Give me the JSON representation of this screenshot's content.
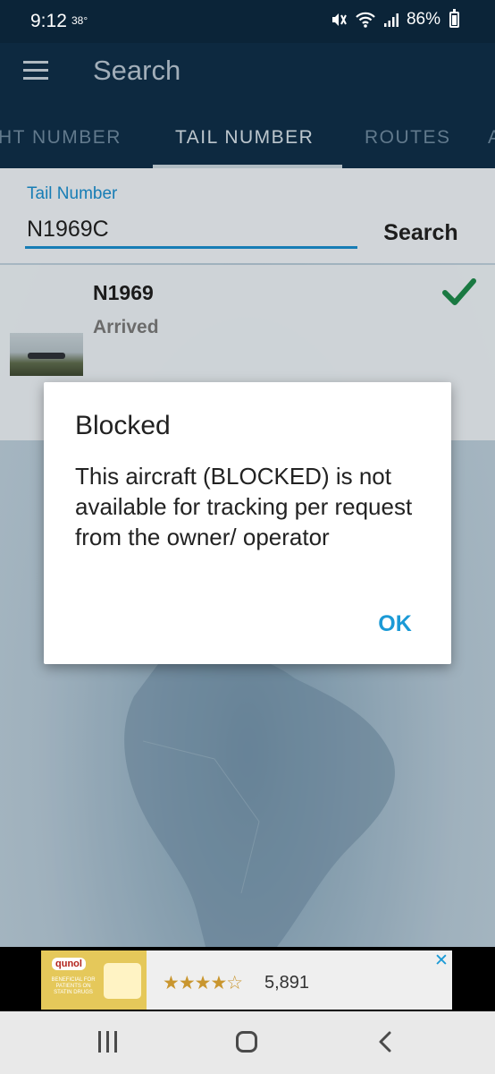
{
  "status_bar": {
    "time": "9:12",
    "temperature": "38°",
    "battery": "86%"
  },
  "app_bar": {
    "title": "Search"
  },
  "tabs": [
    {
      "label": "HT NUMBER",
      "active": false
    },
    {
      "label": "TAIL NUMBER",
      "active": true
    },
    {
      "label": "ROUTES",
      "active": false
    },
    {
      "label": "A",
      "active": false
    }
  ],
  "search": {
    "field_label": "Tail Number",
    "value": "N1969C",
    "button_label": "Search"
  },
  "result": {
    "registration": "N1969",
    "status": "Arrived",
    "status_icon": "checkmark-icon",
    "accent_color": "#1e8a4c"
  },
  "dialog": {
    "title": "Blocked",
    "message": "This aircraft (BLOCKED) is not available for tracking per request from the owner/ operator",
    "ok_label": "OK"
  },
  "ad": {
    "brand": "qunol",
    "product_text": "BENEFICIAL FOR PATIENTS ON STATIN DRUGS",
    "rating": "★★★★☆",
    "review_count": "5,891",
    "close_label": "✕"
  },
  "colors": {
    "primary_dark": "#0f2f49",
    "accent_blue": "#1b8fcf"
  }
}
